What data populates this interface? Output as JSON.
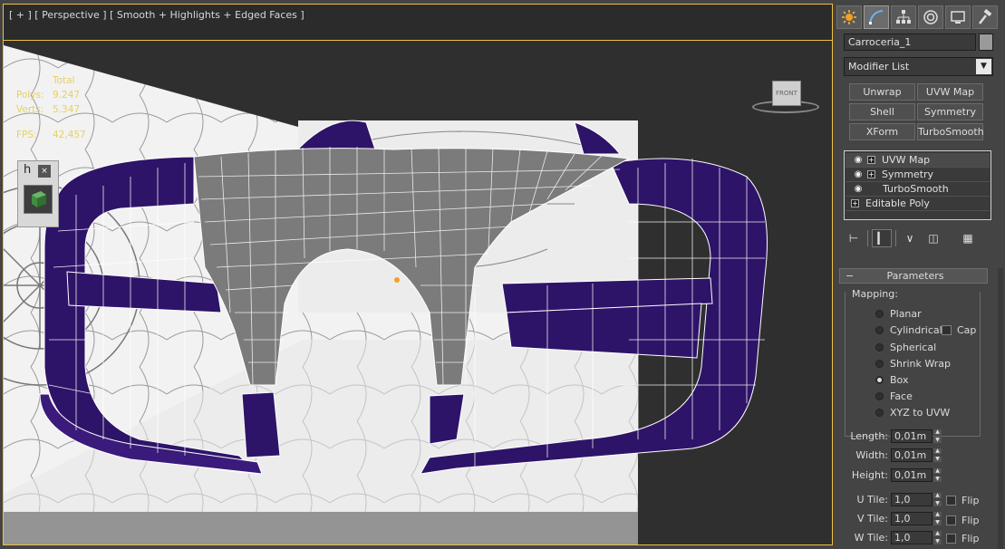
{
  "viewport": {
    "label_parts": [
      "[ + ]",
      "[ Perspective ]",
      "[ Smooth + Highlights + Edged Faces ]"
    ],
    "stats": {
      "total_label": "Total",
      "polys_label": "Polys:",
      "polys_value": "9.247",
      "verts_label": "Verts:",
      "verts_value": "5.347",
      "fps_label": "FPS:",
      "fps_value": "42,457"
    },
    "mini_panel": {
      "h_label": "h",
      "close_label": "×"
    },
    "viewcube_label": "FRONT"
  },
  "command_panel": {
    "tabs": [
      {
        "icon": "sun-icon",
        "active": false
      },
      {
        "icon": "modify-curve-icon",
        "active": true
      },
      {
        "icon": "hierarchy-icon",
        "active": false
      },
      {
        "icon": "motion-icon",
        "active": false
      },
      {
        "icon": "display-icon",
        "active": false
      },
      {
        "icon": "hammer-icon",
        "active": false
      }
    ],
    "object_name": "Carroceria_1",
    "modifier_list_label": "Modifier List",
    "modifier_buttons": [
      "Unwrap UVW",
      "UVW Map",
      "Shell",
      "Symmetry",
      "XForm",
      "TurboSmooth"
    ],
    "stack": [
      {
        "label": "UVW Map",
        "bulb": true,
        "plus": true,
        "selected": true
      },
      {
        "label": "Symmetry",
        "bulb": true,
        "plus": true,
        "selected": false
      },
      {
        "label": "TurboSmooth",
        "bulb": true,
        "plus": false,
        "selected": false
      },
      {
        "label": "Editable Poly",
        "bulb": false,
        "plus": true,
        "selected": false
      }
    ],
    "parameters": {
      "rollout_sign": "−",
      "rollout_title": "Parameters",
      "mapping_label": "Mapping:",
      "mapping_options": [
        "Planar",
        "Cylindrical",
        "Spherical",
        "Shrink Wrap",
        "Box",
        "Face",
        "XYZ to UVW"
      ],
      "mapping_selected": "Box",
      "cap_label": "Cap",
      "length_label": "Length:",
      "length_value": "0,01m",
      "width_label": "Width:",
      "width_value": "0,01m",
      "height_label": "Height:",
      "height_value": "0,01m",
      "u_tile_label": "U Tile:",
      "u_tile_value": "1,0",
      "v_tile_label": "V Tile:",
      "v_tile_value": "1,0",
      "w_tile_label": "W Tile:",
      "w_tile_value": "1,0",
      "flip_label": "Flip"
    }
  },
  "colors": {
    "active_viewport_border": "#f0c040",
    "mesh_purple": "#2e1468",
    "mesh_gray": "#7a7a7a",
    "stats_yellow": "#e6d060"
  }
}
